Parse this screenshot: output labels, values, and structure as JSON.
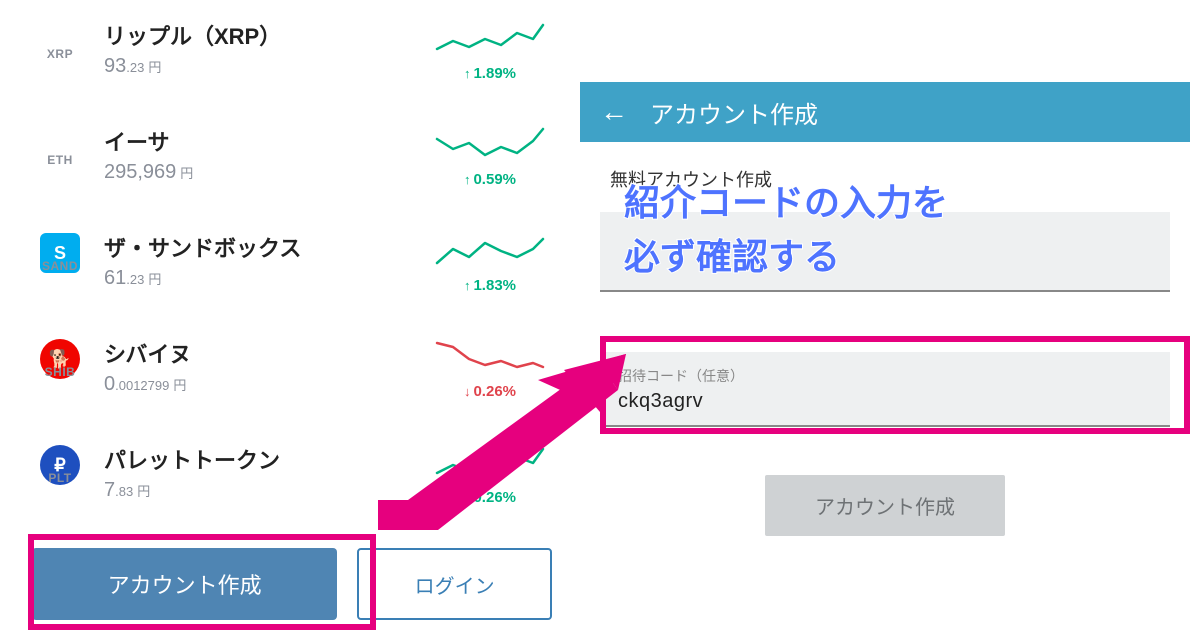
{
  "coins": [
    {
      "ticker": "XRP",
      "name": "リップル（XRP）",
      "price_int": "93",
      "price_dec": ".23",
      "unit": "円",
      "pct": "1.89%",
      "dir": "up",
      "icon_bg": "",
      "icon_letter": ""
    },
    {
      "ticker": "ETH",
      "name": "イーサ",
      "price_int": "295,969",
      "price_dec": "",
      "unit": "円",
      "pct": "0.59%",
      "dir": "up",
      "icon_bg": "",
      "icon_letter": ""
    },
    {
      "ticker": "SAND",
      "name": "ザ・サンドボックス",
      "price_int": "61",
      "price_dec": ".23",
      "unit": "円",
      "pct": "1.83%",
      "dir": "up",
      "icon_bg": "#00adef",
      "icon_letter": "S",
      "square": true
    },
    {
      "ticker": "SHIB",
      "name": "シバイヌ",
      "price_int": "0",
      "price_dec": ".0012799",
      "unit": "円",
      "pct": "0.26%",
      "dir": "down",
      "icon_bg": "#f00500",
      "icon_letter": "🐕"
    },
    {
      "ticker": "PLT",
      "name": "パレットトークン",
      "price_int": "7",
      "price_dec": ".83",
      "unit": "円",
      "pct": "0.26%",
      "dir": "up",
      "icon_bg": "#1e4fbf",
      "icon_letter": "₽"
    }
  ],
  "buttons": {
    "create": "アカウント作成",
    "login": "ログイン"
  },
  "right": {
    "title": "アカウント作成",
    "subhead": "無料アカウント作成",
    "invite_label": "招待コード（任意）",
    "invite_value": "ckq3agrv",
    "submit": "アカウント作成"
  },
  "overlay": {
    "line1": "紹介コードの入力を",
    "line2": "必ず確認する"
  },
  "colors": {
    "accent": "#3fa2c7",
    "primary_button": "#4f85b3",
    "highlight_pink": "#e6007e",
    "up": "#00b383",
    "down": "#e0434c"
  }
}
